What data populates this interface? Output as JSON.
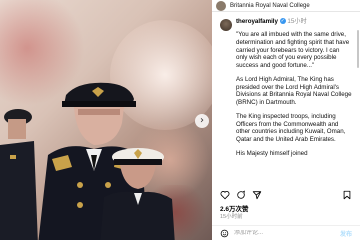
{
  "header": {
    "location": "Britannia Royal Naval College"
  },
  "post": {
    "username": "theroyalfamily",
    "verified_icon": "verified-badge",
    "time": "15小时",
    "paragraphs": [
      "\"You are all imbued with the same drive, determination and fighting spirit that have carried your forebears to victory. I can only wish each of you every possible success and good fortune...\"",
      "As Lord High Admiral, The King has presided over the Lord High Admiral's Divisions at Britannia Royal Naval College (BRNC) in Dartmouth.",
      "The King inspected troops, including Officers from the Commonwealth and other countries including Kuwait, Oman, Qatar and the United Arab Emirates.",
      "His Majesty himself joined"
    ],
    "likes": "2.6万次赞",
    "date": "15小时前",
    "comment_placeholder": "添加评论...",
    "post_label": "发布"
  },
  "icons": {
    "next": "chevron-right-icon",
    "like": "heart-icon",
    "comment": "comment-icon",
    "share": "share-icon",
    "save": "bookmark-icon",
    "emoji": "emoji-icon"
  }
}
